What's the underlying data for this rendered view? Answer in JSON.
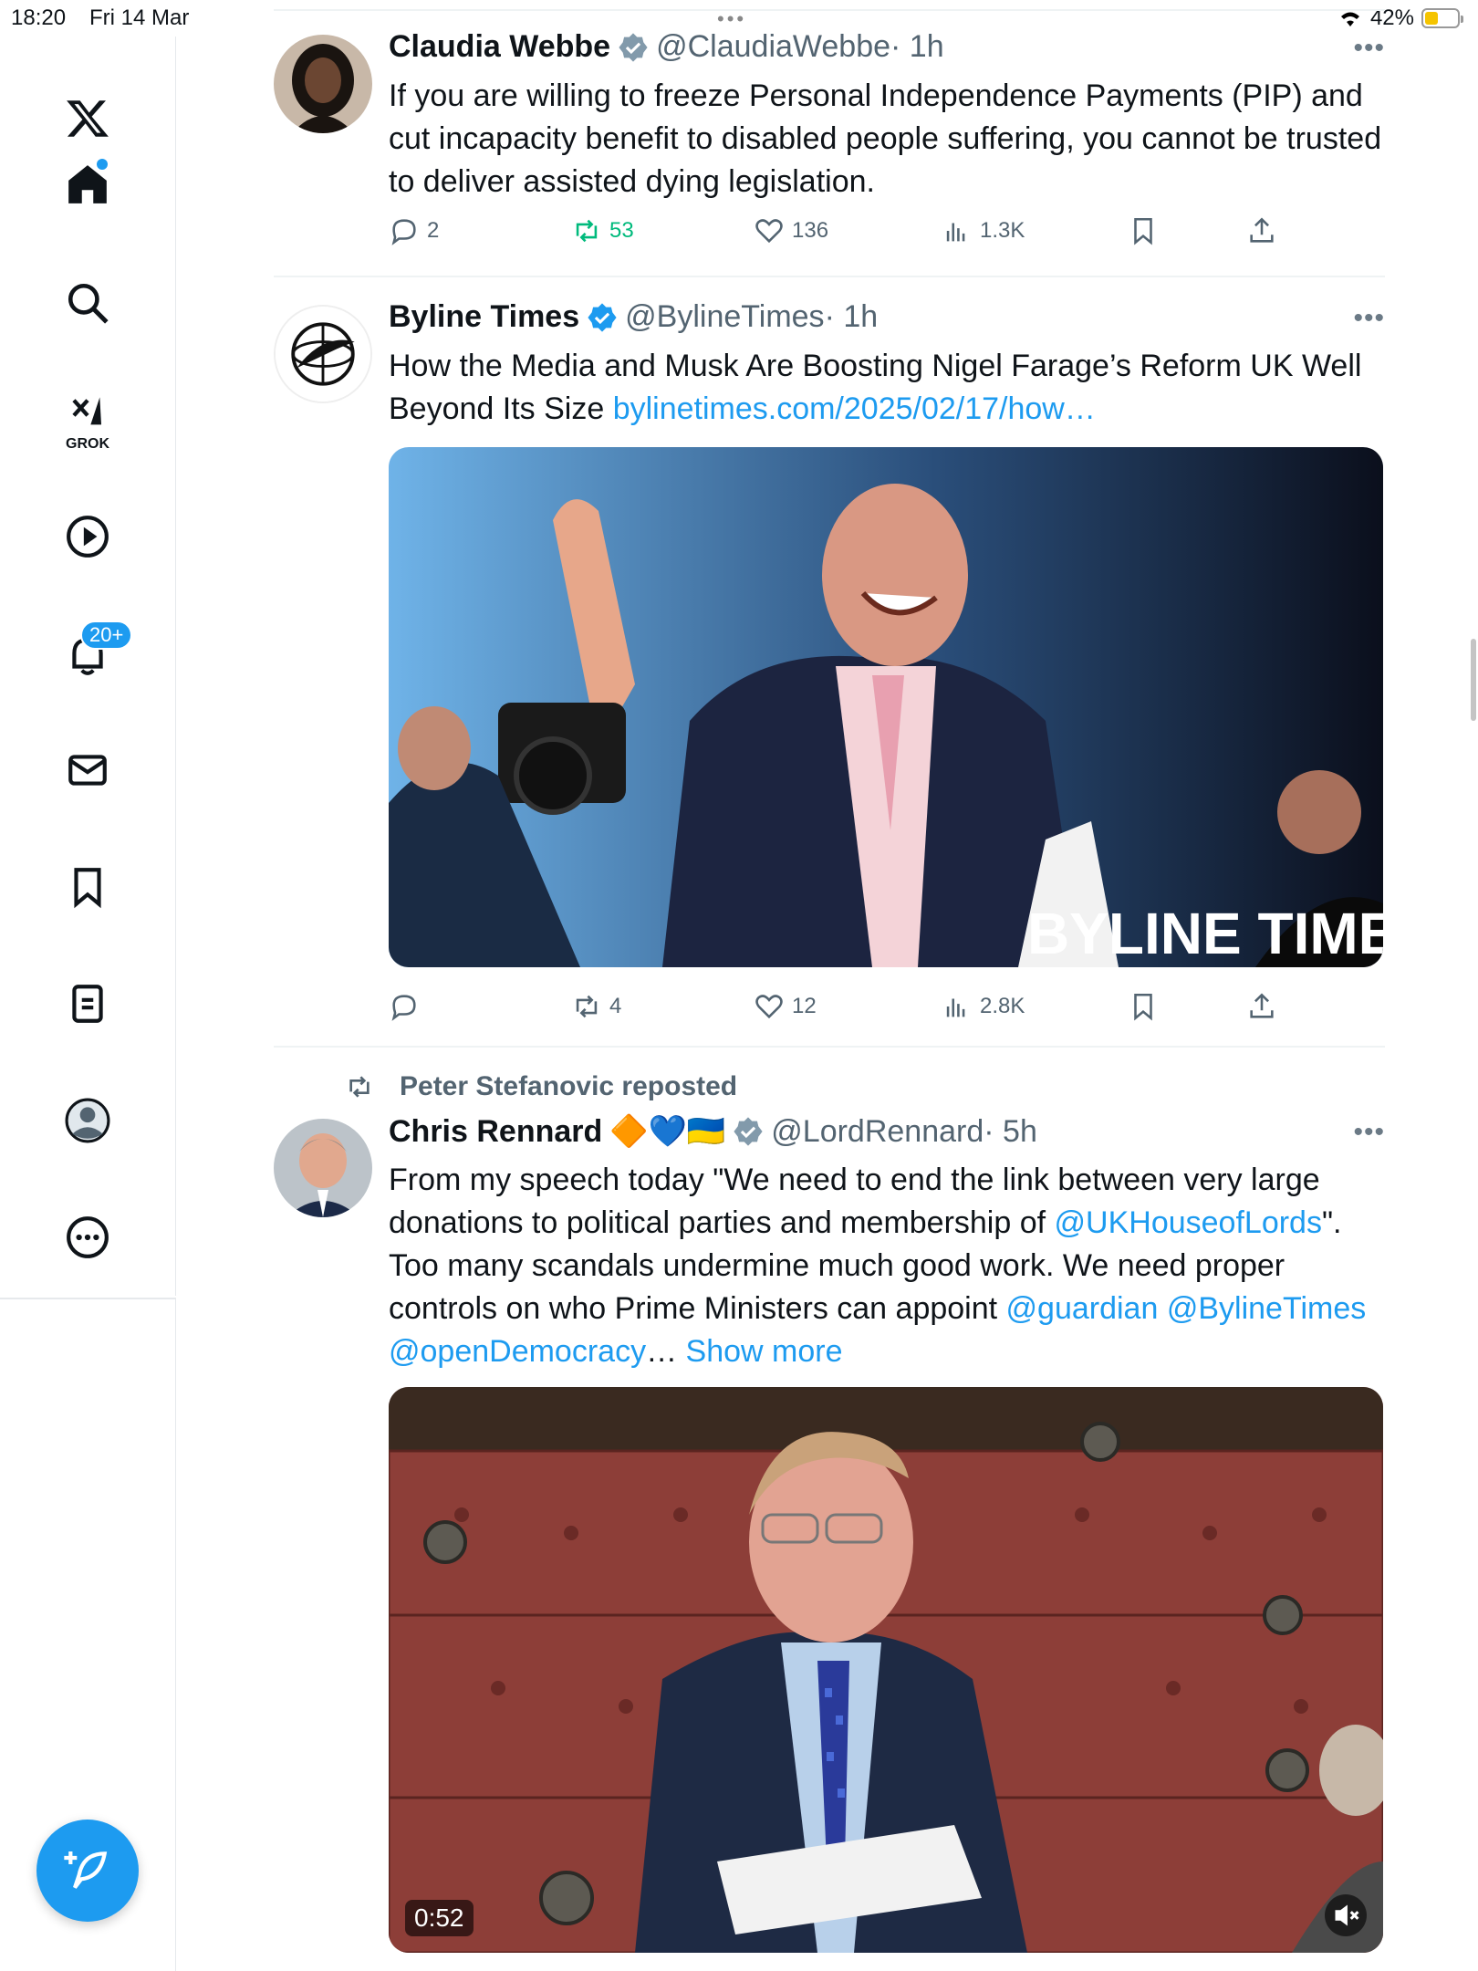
{
  "status_bar": {
    "time": "18:20",
    "date": "Fri 14 Mar",
    "battery": "42%"
  },
  "sidebar": {
    "grok_label": "GROK",
    "notification_badge": "20+"
  },
  "tweets": [
    {
      "name": "Claudia Webbe",
      "handle": "@ClaudiaWebbe",
      "time": "· 1h",
      "text": "If you are willing to freeze Personal Independence Payments (PIP) and cut incapacity benefit to disabled people suffering, you cannot be trusted to deliver assisted dying legislation.",
      "replies": "2",
      "reposts": "53",
      "likes": "136",
      "views": "1.3K"
    },
    {
      "name": "Byline Times",
      "handle": "@BylineTimes",
      "time": "· 1h",
      "text": "How the Media and Musk Are Boosting Nigel Farage’s Reform UK Well Beyond Its Size ",
      "link": "bylinetimes.com/2025/02/17/how…",
      "image_watermark": "BYLINE TIMES",
      "replies": "",
      "reposts": "4",
      "likes": "12",
      "views": "2.8K"
    },
    {
      "reposted_by": "Peter Stefanovic reposted",
      "name": "Chris Rennard",
      "name_emojis": "🔶💙🇺🇦",
      "handle": "@LordRennard",
      "time": "· 5h",
      "text_1": "From my speech today \"We need to end the link between very large donations to political parties and membership of ",
      "mention_1": "@UKHouseofLords",
      "text_2": "\". Too many scandals undermine much good work.  We need proper controls on who Prime Ministers can appoint ",
      "mention_2": "@guardian",
      "mention_3": "@BylineTimes",
      "mention_4": "@openDemocracy",
      "ellipsis": "… ",
      "show_more": "Show more",
      "video_time": "0:52"
    }
  ]
}
